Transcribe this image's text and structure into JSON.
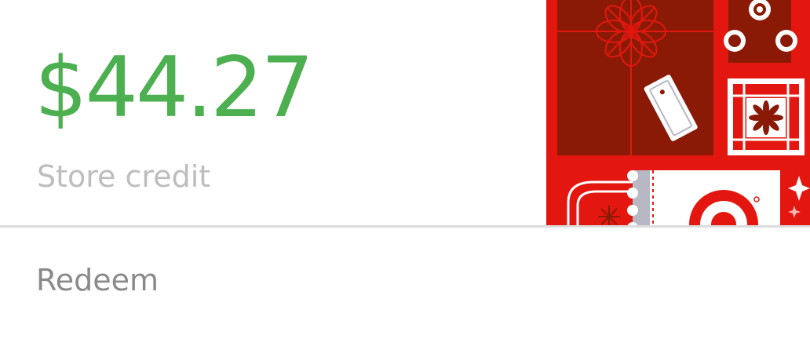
{
  "balance": {
    "amount": "$44.27",
    "label": "Store credit"
  },
  "artwork": {
    "description_icon": "gift-card-art-icon"
  },
  "action": {
    "redeem_label": "Redeem"
  },
  "colors": {
    "amount": "#4caf50",
    "subtitle": "#bdbdbd",
    "redeem": "#8a8a8a",
    "divider": "#dcdcdc",
    "art_red": "#e3170f",
    "art_dark_red": "#8a1a05"
  }
}
